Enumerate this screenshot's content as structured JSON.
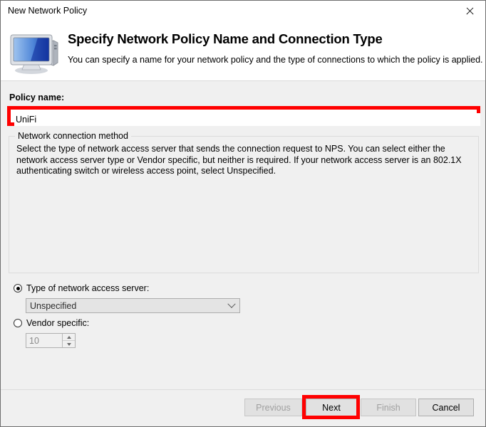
{
  "window": {
    "title": "New Network Policy",
    "close_icon": "close-icon"
  },
  "header": {
    "icon": "computer-monitor-icon",
    "title": "Specify Network Policy Name and Connection Type",
    "subtitle": "You can specify a name for your network policy and the type of connections to which the policy is applied."
  },
  "main": {
    "policy_name_label": "Policy name:",
    "policy_name_value": "UniFi",
    "policy_name_placeholder": "",
    "group": {
      "title": "Network connection method",
      "description": "Select the type of network access server that sends the connection request to NPS. You can select either the network access server type or Vendor specific, but neither is required.  If your network access server is an 802.1X authenticating switch or wireless access point, select Unspecified.",
      "radio_nas_label": "Type of network access server:",
      "radio_vendor_label": "Vendor specific:",
      "nas_selected_option": "Unspecified",
      "nas_options": [
        "Unspecified"
      ],
      "vendor_value": "10",
      "dropdown_icon": "chevron-down-icon",
      "spinner_up_icon": "spinner-up-arrow-icon",
      "spinner_down_icon": "spinner-down-arrow-icon"
    }
  },
  "footer": {
    "previous_label": "Previous",
    "next_label": "Next",
    "finish_label": "Finish",
    "cancel_label": "Cancel"
  },
  "annotations": {
    "highlight_color": "#ff0000",
    "highlight_targets": [
      "policy-name-input",
      "next-button"
    ]
  }
}
